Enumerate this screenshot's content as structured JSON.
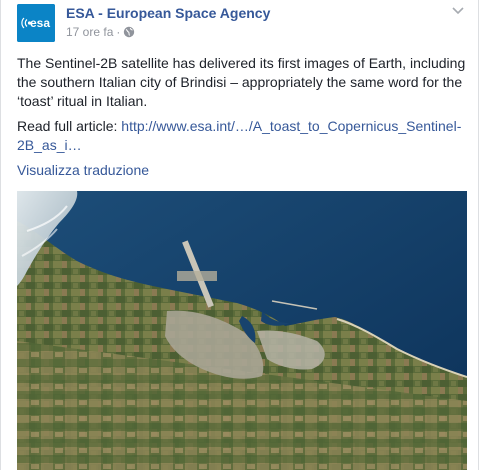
{
  "post": {
    "page_name": "ESA - European Space Agency",
    "avatar_text": "esa",
    "timestamp": "17 ore fa",
    "separator": "·",
    "paragraph": "The Sentinel-2B satellite has delivered its first images of Earth, including the southern Italian city of Brindisi – appropriately the same word for the ‘toast’ ritual in Italian.",
    "read_more_label": "Read full article: ",
    "read_more_link": "http://www.esa.int/…/A_toast_to_Copernicus_Sentinel-2B_as_i…",
    "translate_label": "Visualizza traduzione"
  },
  "icons": {
    "privacy": "globe-icon",
    "menu": "chevron-down-icon"
  },
  "colors": {
    "link": "#365899",
    "meta": "#90949c",
    "text": "#1d2129",
    "esa_blue": "#0b84c6",
    "sea": "#0f3a63"
  }
}
